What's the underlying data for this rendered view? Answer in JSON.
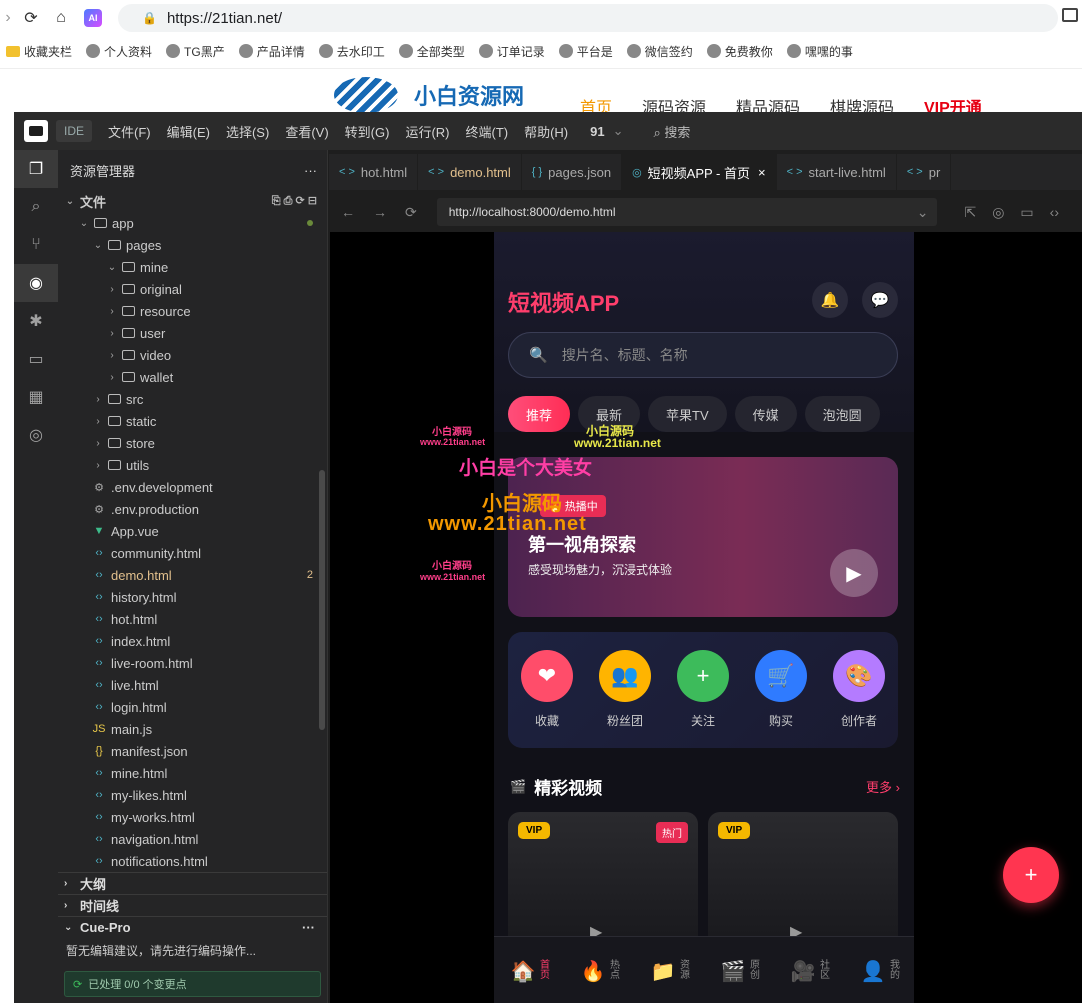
{
  "browser": {
    "url": "https://21tian.net/",
    "ai_label": "AI",
    "bookmarks": [
      "收藏夹栏",
      "个人资料",
      "TG黑产",
      "产品详情",
      "去水印工",
      "全部类型",
      "订单记录",
      "平台是",
      "微信签约",
      "免费教你",
      "嘿嘿的事"
    ]
  },
  "site": {
    "logo_text": "小白资源网",
    "nav": [
      "首页",
      "源码资源",
      "精品源码",
      "棋牌源码",
      "VIP开通"
    ]
  },
  "ide": {
    "tag": "IDE",
    "menus": [
      "文件(F)",
      "编辑(E)",
      "选择(S)",
      "查看(V)",
      "转到(G)",
      "运行(R)",
      "终端(T)",
      "帮助(H)"
    ],
    "number": "91",
    "search": "搜索",
    "explorer_title": "资源管理器",
    "files_label": "文件",
    "tree": [
      {
        "name": "app",
        "type": "folder",
        "open": true,
        "indent": 1
      },
      {
        "name": "pages",
        "type": "folder",
        "open": true,
        "indent": 2
      },
      {
        "name": "mine",
        "type": "folder",
        "open": true,
        "indent": 3
      },
      {
        "name": "original",
        "type": "folder",
        "indent": 3
      },
      {
        "name": "resource",
        "type": "folder",
        "indent": 3
      },
      {
        "name": "user",
        "type": "folder",
        "indent": 3
      },
      {
        "name": "video",
        "type": "folder",
        "indent": 3
      },
      {
        "name": "wallet",
        "type": "folder",
        "indent": 3
      },
      {
        "name": "src",
        "type": "folder",
        "indent": 2
      },
      {
        "name": "static",
        "type": "folder",
        "indent": 2
      },
      {
        "name": "store",
        "type": "folder",
        "indent": 2
      },
      {
        "name": "utils",
        "type": "folder",
        "indent": 2
      },
      {
        "name": ".env.development",
        "type": "gear",
        "indent": 2
      },
      {
        "name": ".env.production",
        "type": "gear",
        "indent": 2
      },
      {
        "name": "App.vue",
        "type": "vue",
        "indent": 2
      },
      {
        "name": "community.html",
        "type": "html",
        "indent": 2
      },
      {
        "name": "demo.html",
        "type": "html",
        "indent": 2,
        "active": true,
        "badge": "2"
      },
      {
        "name": "history.html",
        "type": "html",
        "indent": 2
      },
      {
        "name": "hot.html",
        "type": "html",
        "indent": 2
      },
      {
        "name": "index.html",
        "type": "html",
        "indent": 2
      },
      {
        "name": "live-room.html",
        "type": "html",
        "indent": 2
      },
      {
        "name": "live.html",
        "type": "html",
        "indent": 2
      },
      {
        "name": "login.html",
        "type": "html",
        "indent": 2
      },
      {
        "name": "main.js",
        "type": "js",
        "indent": 2
      },
      {
        "name": "manifest.json",
        "type": "json",
        "indent": 2
      },
      {
        "name": "mine.html",
        "type": "html",
        "indent": 2
      },
      {
        "name": "my-likes.html",
        "type": "html",
        "indent": 2
      },
      {
        "name": "my-works.html",
        "type": "html",
        "indent": 2
      },
      {
        "name": "navigation.html",
        "type": "html",
        "indent": 2
      },
      {
        "name": "notifications.html",
        "type": "html",
        "indent": 2
      }
    ],
    "panels": [
      "大纲",
      "时间线",
      "Cue-Pro"
    ],
    "cue_message": "暂无编辑建议，请先进行编码操作...",
    "cue_status": "已处理 0/0 个变更点",
    "tabs": [
      {
        "label": "hot.html",
        "icon": "< >"
      },
      {
        "label": "demo.html",
        "icon": "< >",
        "modified": true
      },
      {
        "label": "pages.json",
        "icon": "{ }"
      },
      {
        "label": "短视频APP - 首页",
        "icon": "◎",
        "active": true
      },
      {
        "label": "start-live.html",
        "icon": "< >"
      },
      {
        "label": "pr",
        "icon": "< >"
      }
    ],
    "preview_url": "http://localhost:8000/demo.html"
  },
  "app": {
    "title": "短视频APP",
    "search_placeholder": "搜片名、标题、名称",
    "categories": [
      "推荐",
      "最新",
      "苹果TV",
      "传媒",
      "泡泡圆"
    ],
    "banner": {
      "badge": "🔥 热播中",
      "title": "第一视角探索",
      "subtitle": "感受现场魅力，沉浸式体验"
    },
    "quick_actions": [
      {
        "label": "收藏",
        "icon": "❤",
        "color": "#ff4d6a"
      },
      {
        "label": "粉丝团",
        "icon": "👥",
        "color": "#ffb400"
      },
      {
        "label": "关注",
        "icon": "+",
        "color": "#3dbb5b"
      },
      {
        "label": "购买",
        "icon": "🛒",
        "color": "#2f7bff"
      },
      {
        "label": "创作者",
        "icon": "🎨",
        "color": "#b47bff"
      }
    ],
    "section_title": "精彩视频",
    "section_more": "更多 ›",
    "vip_label": "VIP",
    "hot_label": "热门",
    "bottom_nav": [
      {
        "label": "首页",
        "icon": "🏠",
        "active": true
      },
      {
        "label": "热点",
        "icon": "🔥"
      },
      {
        "label": "资源",
        "icon": "📁"
      },
      {
        "label": "原创",
        "icon": "🎬"
      },
      {
        "label": "社区",
        "icon": "🎥"
      },
      {
        "label": "我的",
        "icon": "👤"
      }
    ],
    "fab": "+"
  },
  "watermarks": [
    "小白源码",
    "www.21tian.net",
    "小白是个大美女",
    "小白源码",
    "www.21tian.net",
    "小白源码",
    "www.21tian.net",
    "小白源码",
    "www.21tian.net"
  ]
}
